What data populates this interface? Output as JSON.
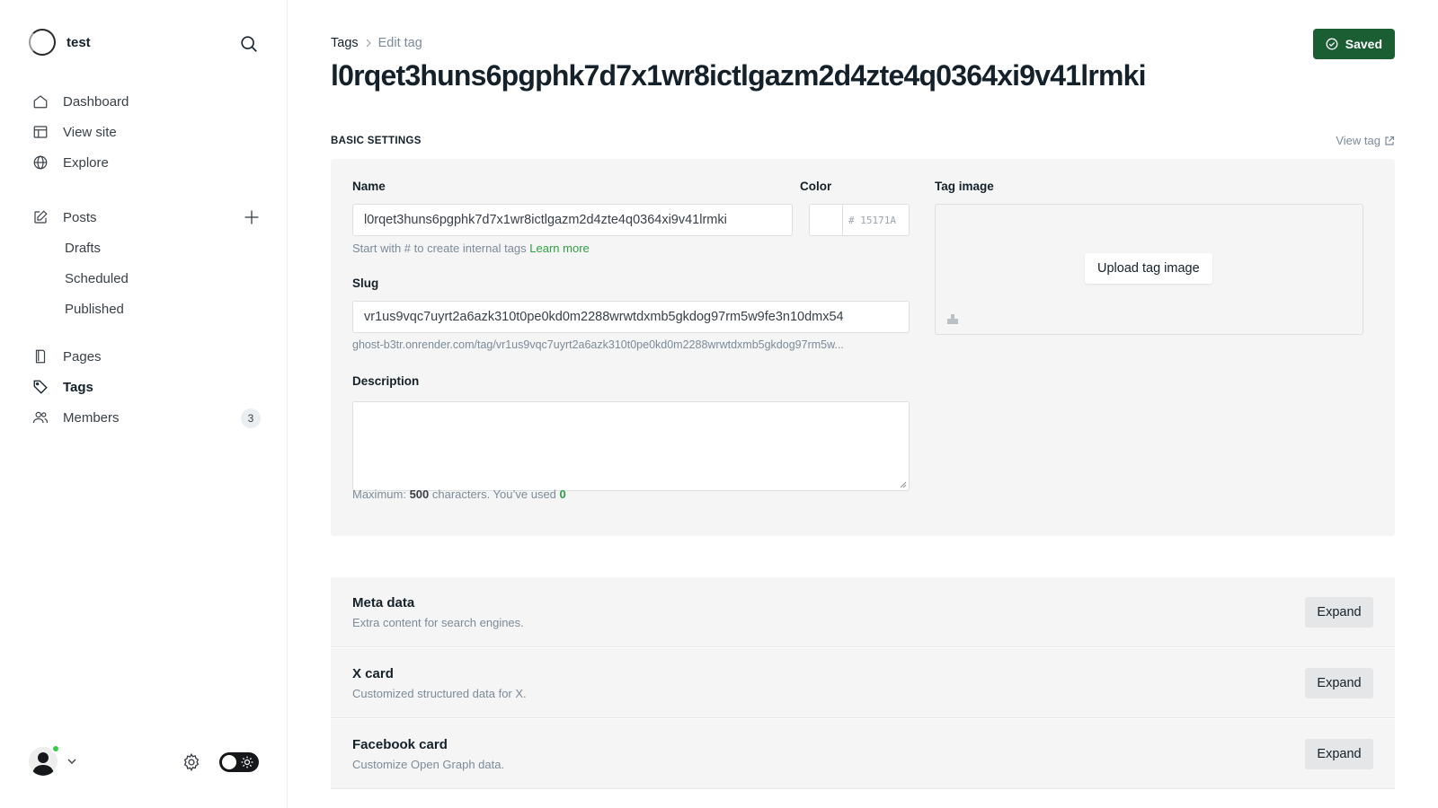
{
  "sidebar": {
    "site_name": "test",
    "nav": {
      "dashboard": "Dashboard",
      "view_site": "View site",
      "explore": "Explore",
      "posts": "Posts",
      "drafts": "Drafts",
      "scheduled": "Scheduled",
      "published": "Published",
      "pages": "Pages",
      "tags": "Tags",
      "members": "Members",
      "members_count": "3"
    }
  },
  "header": {
    "breadcrumb_parent": "Tags",
    "breadcrumb_current": "Edit tag",
    "title": "l0rqet3huns6pgphk7d7x1wr8ictlgazm2d4zte4q0364xi9v41lrmki",
    "saved_label": "Saved"
  },
  "basic": {
    "section_title": "BASIC SETTINGS",
    "view_tag_label": "View tag",
    "name_label": "Name",
    "name_value": "l0rqet3huns6pgphk7d7x1wr8ictlgazm2d4zte4q0364xi9v41lrmki",
    "name_hint": "Start with # to create internal tags",
    "learn_more": "Learn more",
    "color_label": "Color",
    "color_placeholder": "# 15171A",
    "slug_label": "Slug",
    "slug_value": "vr1us9vqc7uyrt2a6azk310t0pe0kd0m2288wrwtdxmb5gkdog97rm5w9fe3n10dmx54",
    "slug_url": "ghost-b3tr.onrender.com/tag/vr1us9vqc7uyrt2a6azk310t0pe0kd0m2288wrwtdxmb5gkdog97rm5w...",
    "description_label": "Description",
    "desc_hint_prefix": "Maximum: ",
    "desc_max": "500",
    "desc_hint_mid": " characters. You’ve used ",
    "desc_used": "0",
    "tag_image_label": "Tag image",
    "upload_label": "Upload tag image"
  },
  "accordions": [
    {
      "title": "Meta data",
      "desc": "Extra content for search engines.",
      "button": "Expand"
    },
    {
      "title": "X card",
      "desc": "Customized structured data for X.",
      "button": "Expand"
    },
    {
      "title": "Facebook card",
      "desc": "Customize Open Graph data.",
      "button": "Expand"
    }
  ],
  "colors": {
    "accent_green": "#30a043",
    "saved_bg": "#1b5e33",
    "online": "#30cf43"
  }
}
